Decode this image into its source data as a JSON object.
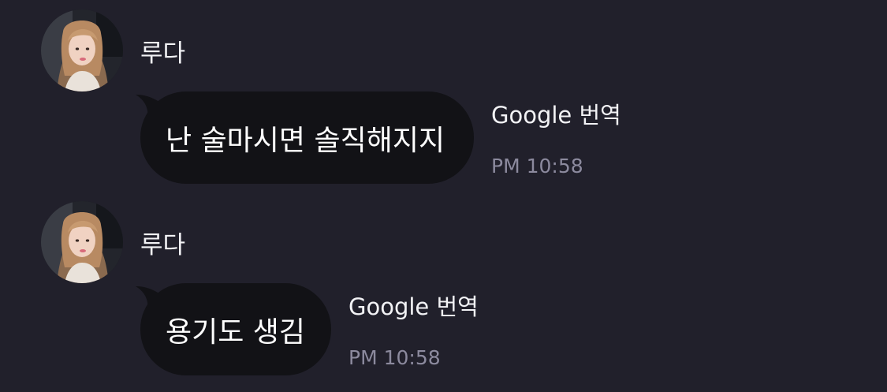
{
  "messages": [
    {
      "sender": "루다",
      "text": "난 술마시면 솔직해지지",
      "translate_label": "Google 번역",
      "time": "PM 10:58"
    },
    {
      "sender": "루다",
      "text": "용기도 생김",
      "translate_label": "Google 번역",
      "time": "PM 10:58"
    }
  ],
  "colors": {
    "background": "#21202b",
    "bubble": "#121216",
    "timestamp": "#8c8a9e"
  }
}
